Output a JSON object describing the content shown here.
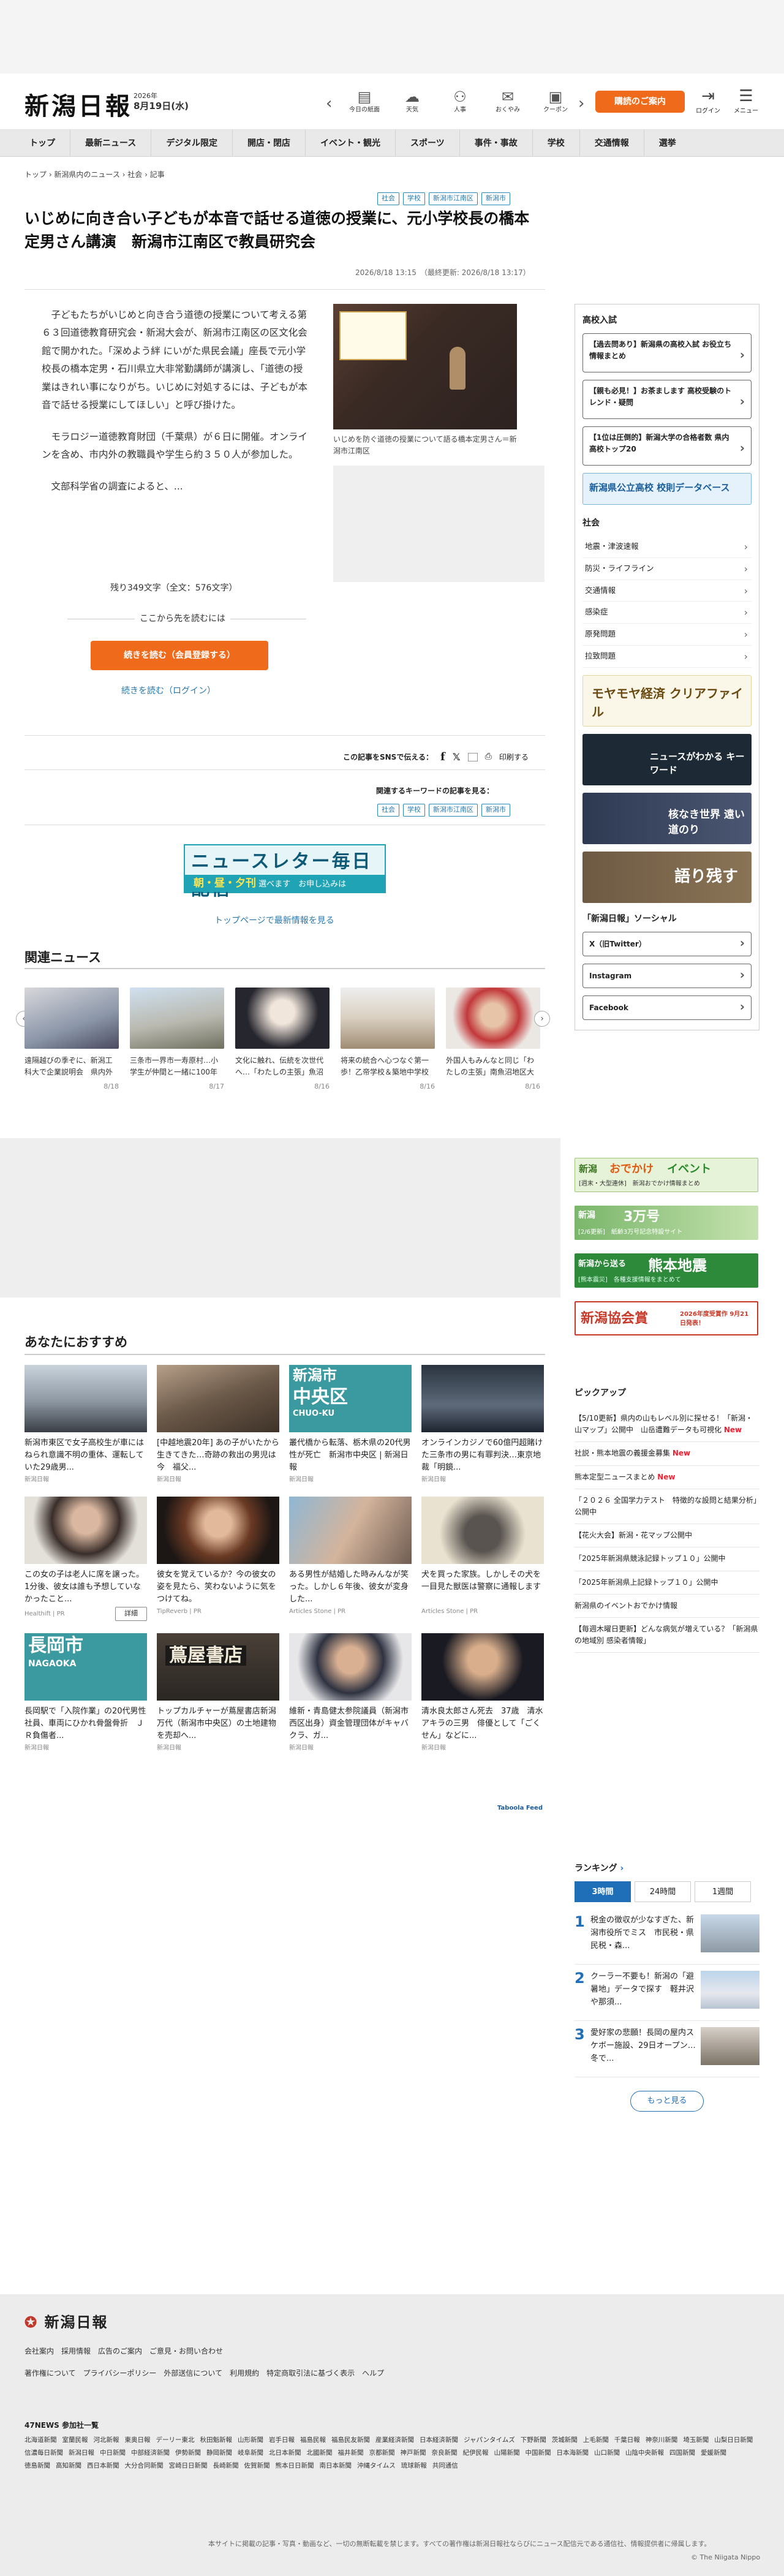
{
  "header": {
    "logo": "新潟日報",
    "date_year": "2026年",
    "date_day": "8月19日(水)",
    "cta": "購読のご案内",
    "login": "ログイン",
    "menu": "メニュー",
    "tools": [
      {
        "label": "今日の紙面",
        "icon": "newspaper-icon"
      },
      {
        "label": "天気",
        "icon": "weather-icon"
      },
      {
        "label": "人事",
        "icon": "people-icon"
      },
      {
        "label": "おくやみ",
        "icon": "condolence-icon"
      },
      {
        "label": "クーポン",
        "icon": "coupon-icon"
      }
    ]
  },
  "nav": [
    "トップ",
    "最新ニュース",
    "デジタル限定",
    "開店・閉店",
    "イベント・観光",
    "スポーツ",
    "事件・事故",
    "学校",
    "交通情報",
    "選挙"
  ],
  "breadcrumb": "トップ › 新潟県内のニュース › 社会 › 記事",
  "article": {
    "tags_top": [
      "社会",
      "学校",
      "新潟市江南区",
      "新潟市"
    ],
    "title": "いじめに向き合い子どもが本音で話せる道徳の授業に、元小学校長の橋本定男さん講演　新潟市江南区で教員研究会",
    "dates": "2026/8/18 13:15　（最終更新: 2026/8/18 13:17）",
    "p1": "子どもたちがいじめと向き合う道徳の授業について考える第６３回道徳教育研究会・新潟大会が、新潟市江南区の区文化会館で開かれた。「深めよう絆 にいがた県民会議」座長で元小学校長の橋本定男・石川県立大非常勤講師が講演し、「道徳の授業はきれい事になりがち。いじめに対処するには、子どもが本音で話せる授業にしてほしい」と呼び掛けた。",
    "p2": "モラロジー道徳教育財団（千葉県）が６日に開催。オンラインを含め、市内外の教職員や学生ら約３５０人が参加した。",
    "p3": "文部科学省の調査によると、...",
    "caption": "いじめを防ぐ道徳の授業について語る橋本定男さん＝新潟市江南区",
    "remaining": "残り349文字（全文：576文字）",
    "continue_label": "ここから先を読むには",
    "read_button": "続きを読む（会員登録する）",
    "login_link": "続きを読む（ログイン）",
    "sns_label": "この記事をSNSで伝える：",
    "print": "印刷する",
    "keyword_label": "関連するキーワードの記事を見る：",
    "tags_bottom": [
      "社会",
      "学校",
      "新潟市江南区",
      "新潟市"
    ]
  },
  "newsletter": {
    "title": "ニュースレター毎日配信",
    "sub": "朝・昼・夕刊",
    "sub2": "選べます",
    "signup": "お申し込みは"
  },
  "top_link": "トップページで最新情報を見る",
  "related": {
    "title": "関連ニュース",
    "items": [
      {
        "text": "遠隔越びの季ぞに、新潟工科大で企業説明会　県内外の88社が持...",
        "date": "8/18"
      },
      {
        "text": "三条市一界市一寿原村…小学生が仲間と一緒に100年口而辛！南...",
        "date": "8/17"
      },
      {
        "text": "文化に触れ、伝統を次世代へ…「わたしの主張」魚沼地区大会、古...",
        "date": "8/16"
      },
      {
        "text": "将来の統合へ心つなぐ第一歩！乙帝学校＆築地中学校（胎内市）が...",
        "date": "8/16"
      },
      {
        "text": "外国人もみんなと同じ「わたしの主張」南魚沼地区大会、最優秀賞...",
        "date": "8/16"
      }
    ]
  },
  "recommend": {
    "title": "あなたにおすすめ",
    "detail_button": "詳細",
    "items": [
      {
        "text": "新潟市東区で女子高校生が車にはねられ意識不明の重体、運転していた29歳男...",
        "src": "新潟日報"
      },
      {
        "text": "[中越地震20年] あの子がいたから生きてきた…奇跡の救出の男児は今　福父...",
        "src": "新潟日報"
      },
      {
        "text": "叢代橋から転落、栃木県の20代男性が死亡　新潟市中央区 | 新潟日報",
        "src": "新潟日報",
        "lbl": "新潟市",
        "sub": "中央区",
        "sub2": "CHUO-KU"
      },
      {
        "text": "オンラインカジノで60億円超賭けた三条市の男に有罪判決…東京地裁「明鏡...",
        "src": "新潟日報"
      },
      {
        "text": "この女の子は老人に席を譲った。1分後、彼女は誰も予想していなかったこと...",
        "src": "Healthift | PR"
      },
      {
        "text": "彼女を覚えているか？今の彼女の姿を見たら、笑わないように気をつけてね。",
        "src": "TipReverb | PR"
      },
      {
        "text": "ある男性が結婚した時みんなが笑った。しかし６年後、彼女が変身した...",
        "src": "Articles Stone | PR"
      },
      {
        "text": "犬を買った家族。しかしその犬を一目見た獣医は警察に通報します",
        "src": "Articles Stone | PR"
      },
      {
        "text": "長岡駅で「入院作業」の20代男性社員、車両にひかれ骨盤骨折　ＪＲ負傷者...",
        "src": "新潟日報",
        "lbl": "長岡市",
        "sub": "NAGAOKA"
      },
      {
        "text": "トップカルチャーが蔦屋書店新潟万代（新潟市中央区）の土地建物を売却へ...",
        "src": "新潟日報",
        "lbl": "蔦屋書店"
      },
      {
        "text": "維新・青島健太参院議員（新潟市西区出身）資金管理団体がキャバクラ、ガ...",
        "src": "新潟日報"
      },
      {
        "text": "清水良太郎さん死去　37歳　清水アキラの三男　俳優として「ごくせん」などに...",
        "src": "新潟日報"
      }
    ]
  },
  "taboola": "Taboola Feed",
  "sidebar": {
    "school_title": "高校入試",
    "school_buttons": [
      "【過去問あり】新潟県の高校入試 お役立ち情報まとめ",
      "【親も必見！】お茶まします 高校受験のトレンド・疑問",
      "【1位は圧倒的】新潟大学の合格者数 県内高校トップ20"
    ],
    "school_banner": "新潟県公立高校 校則データベース",
    "society_title": "社会",
    "society_items": [
      "地震・津波速報",
      "防災・ライフライン",
      "交通情報",
      "感染症",
      "原発問題",
      "拉致問題"
    ],
    "banner1": "モヤモヤ経済 クリアファイル",
    "banner2": "ニュースがわかる キーワード",
    "banner3": "核なき世界 遠い道のり",
    "banner4": "語り残す",
    "social_title": "「新潟日報」ソーシャル",
    "social_buttons": [
      "X（旧Twitter）",
      "Instagram",
      "Facebook"
    ]
  },
  "ads": [
    {
      "a": "新潟",
      "b": "おでかけ",
      "c": "イベント",
      "d": "[週末・大型連休]　新潟おでかけ情報まとめ"
    },
    {
      "a": "新潟　",
      "b": "3万号",
      "c": "",
      "d": "[2/6更新]　紙齢3万号記念特設サイト"
    },
    {
      "a": "新潟から送る",
      "b": "熊本地震",
      "c": "",
      "d": "[熊本震災]　各種支援情報をまとめて"
    },
    {
      "a": "新潟協会賞",
      "b": "",
      "c": "",
      "d": "2026年度受賞作 9月21日発表！"
    }
  ],
  "pickup": {
    "title": "ピックアップ",
    "items": [
      {
        "text": "【5/10更新】県内の山もレベル別に探せる！「新潟・山マップ」公開中　山岳遭難データも可視化",
        "new": "New"
      },
      {
        "text": "社説・熊本地震の義援金募集",
        "new": "New"
      },
      {
        "text": "熊本定型ニュースまとめ",
        "new": "New"
      },
      {
        "text": "「２０２６ 全国学力テスト　特徴的な設問と結果分析」公開中",
        "new": ""
      },
      {
        "text": "【花火大会】新潟・花マップ公開中",
        "new": ""
      },
      {
        "text": "「2025年新潟県競泳記録トップ１０」公開中",
        "new": ""
      },
      {
        "text": "「2025年新潟県上記録トップ１０」公開中",
        "new": ""
      },
      {
        "text": "新潟県のイベントおでかけ情報",
        "new": ""
      },
      {
        "text": "【毎週木曜日更新】どんな病気が増えている？「新潟県の地域別 感染者情報」",
        "new": ""
      }
    ]
  },
  "ranking": {
    "title": "ランキング",
    "tabs": [
      "3時間",
      "24時間",
      "1週間"
    ],
    "items": [
      {
        "no": "1",
        "text": "税金の徴収が少なすぎた、新潟市役所でミス　市民税・県民税・森..."
      },
      {
        "no": "2",
        "text": "クーラー不要も！新潟の「避暑地」データで探す　軽井沢や那須..."
      },
      {
        "no": "3",
        "text": "愛好家の悲願！長岡の屋内スケボー施設、29日オープン…冬で..."
      }
    ],
    "more": "もっと見る"
  },
  "footer": {
    "logo": "新潟日報",
    "links1": [
      "会社案内",
      "採用情報",
      "広告のご案内",
      "ご意見・お問い合わせ"
    ],
    "links2": [
      "著作権について",
      "プライバシーポリシー",
      "外部送信について",
      "利用規約",
      "特定商取引法に基づく表示",
      "ヘルプ"
    ],
    "news47": "47NEWS 参加社一覧",
    "papers": [
      "北海道新聞",
      "室蘭民報",
      "河北新報",
      "東奥日報",
      "デーリー東北",
      "秋田魁新報",
      "山形新聞",
      "岩手日報",
      "福島民報",
      "福島民友新聞",
      "産業経済新聞",
      "日本経済新聞",
      "ジャパンタイムズ",
      "下野新聞",
      "茨城新聞",
      "上毛新聞",
      "千葉日報",
      "神奈川新聞",
      "埼玉新聞",
      "山梨日日新聞",
      "信濃毎日新聞",
      "新潟日報",
      "中日新聞",
      "中部経済新聞",
      "伊勢新聞",
      "静岡新聞",
      "岐阜新聞",
      "北日本新聞",
      "北國新聞",
      "福井新聞",
      "京都新聞",
      "神戸新聞",
      "奈良新聞",
      "紀伊民報",
      "山陽新聞",
      "中国新聞",
      "日本海新聞",
      "山口新聞",
      "山陰中央新報",
      "四国新聞",
      "愛媛新聞",
      "徳島新聞",
      "高知新聞",
      "西日本新聞",
      "大分合同新聞",
      "宮崎日日新聞",
      "長崎新聞",
      "佐賀新聞",
      "熊本日日新聞",
      "南日本新聞",
      "沖縄タイムス",
      "琉球新報",
      "共同通信"
    ],
    "copy": "本サイトに掲載の記事・写真・動画など、一切の無断転載を禁じます。すべての著作権は新潟日報社ならびにニュース配信元である通信社、情報提供者に帰属します。",
    "copy2": "© The Niigata Nippo"
  },
  "colors": {
    "accent": "#ef6a1a",
    "link": "#2a7ab0",
    "ranking": "#1f6fb8"
  }
}
